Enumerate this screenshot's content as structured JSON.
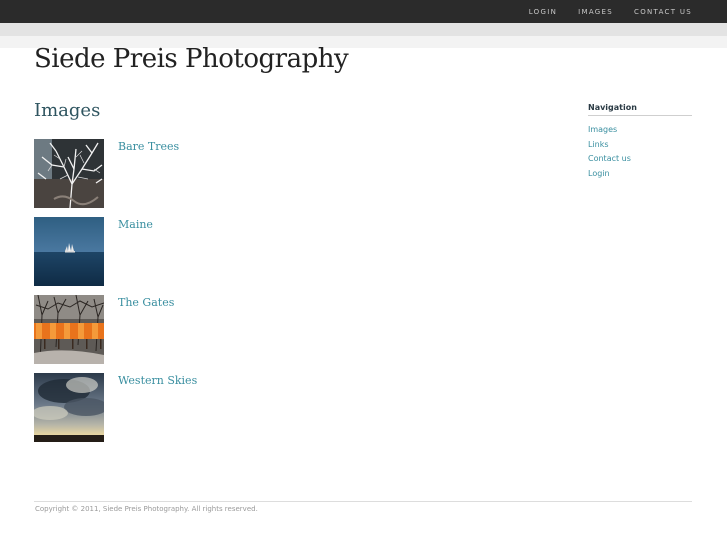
{
  "top_nav": {
    "login": "LOGIN",
    "images": "IMAGES",
    "contact_us": "CONTACT US"
  },
  "site_title": "Siede Preis Photography",
  "page_heading": "Images",
  "gallery": [
    {
      "title": "Bare Trees"
    },
    {
      "title": "Maine"
    },
    {
      "title": "The Gates"
    },
    {
      "title": "Western Skies"
    }
  ],
  "sidebar": {
    "heading": "Navigation",
    "items": [
      "Images",
      "Links",
      "Contact us",
      "Login"
    ]
  },
  "footer": {
    "copyright": "Copyright © 2011, Siede Preis Photography. All rights reserved."
  },
  "colors": {
    "top_bar": "#2b2b2b",
    "link": "#3a8fa0",
    "heading": "#2f5560"
  }
}
